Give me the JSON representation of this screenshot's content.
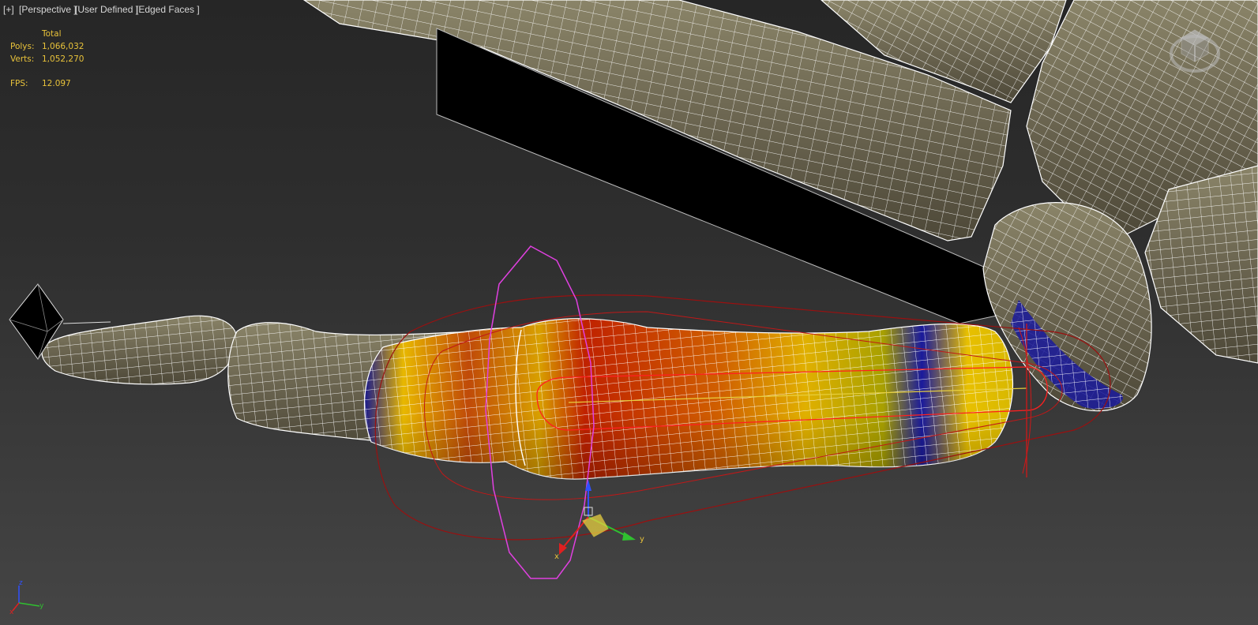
{
  "viewport": {
    "labels": {
      "plus": "[+]",
      "view": "[Perspective ]",
      "camera": "[User Defined ]",
      "shading": "[Edged Faces ]"
    },
    "stats": {
      "total_header": "Total",
      "polys_label": "Polys:",
      "polys_value": "1,066,032",
      "verts_label": "Verts:",
      "verts_value": "1,052,270",
      "fps_label": "FPS:",
      "fps_value": "12.097"
    },
    "gizmo": {
      "x_label": "x",
      "y_label": "y"
    },
    "axis_tripod": {
      "x_label": "x",
      "y_label": "y",
      "z_label": "z"
    }
  },
  "colors": {
    "background_top": "#262626",
    "background_bottom": "#454545",
    "mesh_fill": "#6b6550",
    "wireframe": "#ffffff",
    "stats_text": "#e8c23a",
    "envelope_outer": "#a01010",
    "envelope_inner": "#ff2020",
    "envelope_ring": "#e040e0",
    "weight_high": "#c01800",
    "weight_mid": "#e8b800",
    "weight_low": "#1a1a8c",
    "axis_x": "#e02020",
    "axis_y": "#30c030",
    "axis_z": "#3050ff"
  },
  "icons": {
    "viewcube": "viewcube-icon",
    "point_helper": "point-helper-icon",
    "transform_gizmo": "move-gizmo-icon",
    "axis_tripod": "axis-tripod-icon"
  }
}
